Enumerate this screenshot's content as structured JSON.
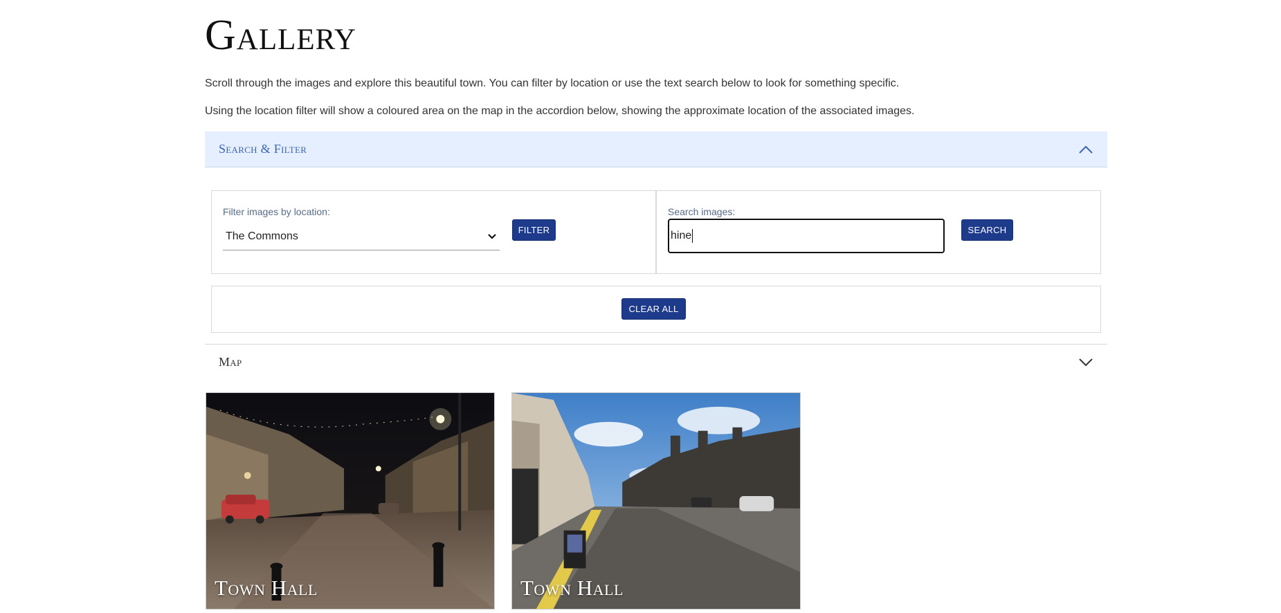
{
  "page": {
    "title": "Gallery",
    "intro_1": "Scroll through the images and explore this beautiful town. You can filter by location or use the text search below to look for something specific.",
    "intro_2": "Using the location filter will show a coloured area on the map in the accordion below, showing the approximate location of the associated images."
  },
  "search_filter": {
    "header": "Search & Filter",
    "expanded": true,
    "filter_label": "Filter images by location:",
    "location_selected": "The Commons",
    "filter_button": "FILTER",
    "search_label": "Search images:",
    "search_value": "hine",
    "search_button": "SEARCH",
    "clear_button": "CLEAR ALL"
  },
  "map": {
    "header": "Map",
    "expanded": false
  },
  "gallery": [
    {
      "title": "Town Hall",
      "scene": "night street"
    },
    {
      "title": "Town Hall",
      "scene": "day street"
    }
  ],
  "colors": {
    "accent": "#1e3a8a",
    "accordion_bg": "#e6efff",
    "accordion_text": "#3a64b4"
  }
}
